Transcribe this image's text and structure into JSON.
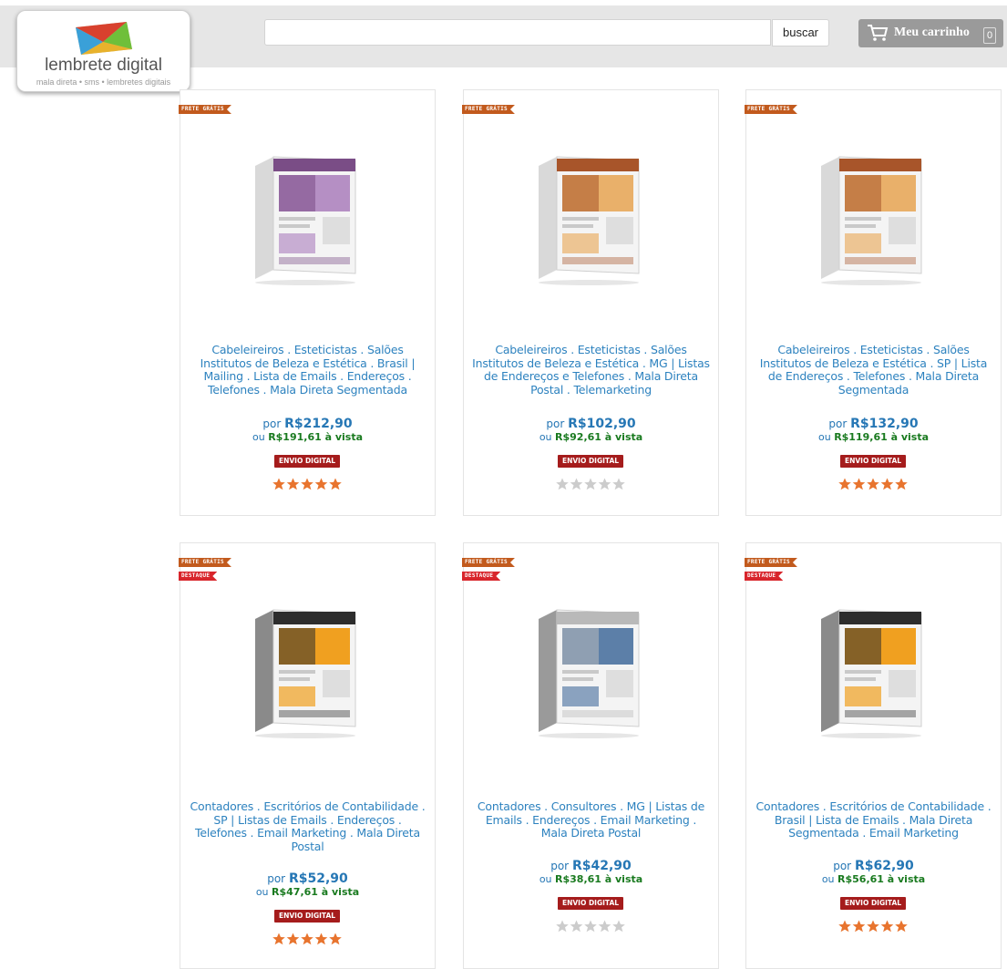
{
  "header": {
    "logo_name": "lembrete digital",
    "logo_tagline": "mala direta • sms • lembretes digitais",
    "search_placeholder": "",
    "search_button": "buscar",
    "cart_label": "Meu carrinho",
    "cart_count": "0"
  },
  "colors": {
    "title_link": "#2d82bf",
    "price": "#2677b5",
    "cash_price": "#197a1f",
    "badge": "#a51c1c",
    "star_filled": "#e8742e",
    "star_empty": "#cccccc"
  },
  "products": [
    {
      "ribbons": [
        "FRETE GRÁTIS"
      ],
      "image": "product-box-purple",
      "title": "Cabeleireiros . Esteticistas . Salões Institutos de Beleza e Estética . Brasil | Mailing . Lista de Emails . Endereços . Telefones . Mala Direta Segmentada",
      "price_prefix": "por",
      "price": "R$212,90",
      "cash_prefix": "ou",
      "cash_price": "R$191,61 à vista",
      "badge": "ENVIO DIGITAL",
      "rating": 5
    },
    {
      "ribbons": [
        "FRETE GRÁTIS"
      ],
      "image": "product-box-salon",
      "title": "Cabeleireiros . Esteticistas . Salões Institutos de Beleza e Estética . MG | Listas de Endereços e Telefones . Mala Direta Postal . Telemarketing",
      "price_prefix": "por",
      "price": "R$102,90",
      "cash_prefix": "ou",
      "cash_price": "R$92,61 à vista",
      "badge": "ENVIO DIGITAL",
      "rating": 0
    },
    {
      "ribbons": [
        "FRETE GRÁTIS"
      ],
      "image": "product-box-salon",
      "title": "Cabeleireiros . Esteticistas . Salões Institutos de Beleza e Estética . SP | Lista de Endereços . Telefones . Mala Direta Segmentada",
      "price_prefix": "por",
      "price": "R$132,90",
      "cash_prefix": "ou",
      "cash_price": "R$119,61 à vista",
      "badge": "ENVIO DIGITAL",
      "rating": 5
    },
    {
      "ribbons": [
        "FRETE GRÁTIS",
        "DESTAQUE"
      ],
      "image": "product-box-banco-dados",
      "title": "Contadores . Escritórios de Contabilidade . SP | Listas de Emails . Endereços . Telefones . Email Marketing . Mala Direta Postal",
      "price_prefix": "por",
      "price": "R$52,90",
      "cash_prefix": "ou",
      "cash_price": "R$47,61 à vista",
      "badge": "ENVIO DIGITAL",
      "rating": 5
    },
    {
      "ribbons": [
        "FRETE GRÁTIS",
        "DESTAQUE"
      ],
      "image": "product-box-banco-dados-gray",
      "title": "Contadores . Consultores . MG | Listas de Emails . Endereços . Email Marketing . Mala Direta Postal",
      "price_prefix": "por",
      "price": "R$42,90",
      "cash_prefix": "ou",
      "cash_price": "R$38,61 à vista",
      "badge": "ENVIO DIGITAL",
      "rating": 0
    },
    {
      "ribbons": [
        "FRETE GRÁTIS",
        "DESTAQUE"
      ],
      "image": "product-box-banco-dados",
      "title": "Contadores . Escritórios de Contabilidade . Brasil | Lista de Emails . Mala Direta Segmentada . Email Marketing",
      "price_prefix": "por",
      "price": "R$62,90",
      "cash_prefix": "ou",
      "cash_price": "R$56,61 à vista",
      "badge": "ENVIO DIGITAL",
      "rating": 5
    }
  ]
}
